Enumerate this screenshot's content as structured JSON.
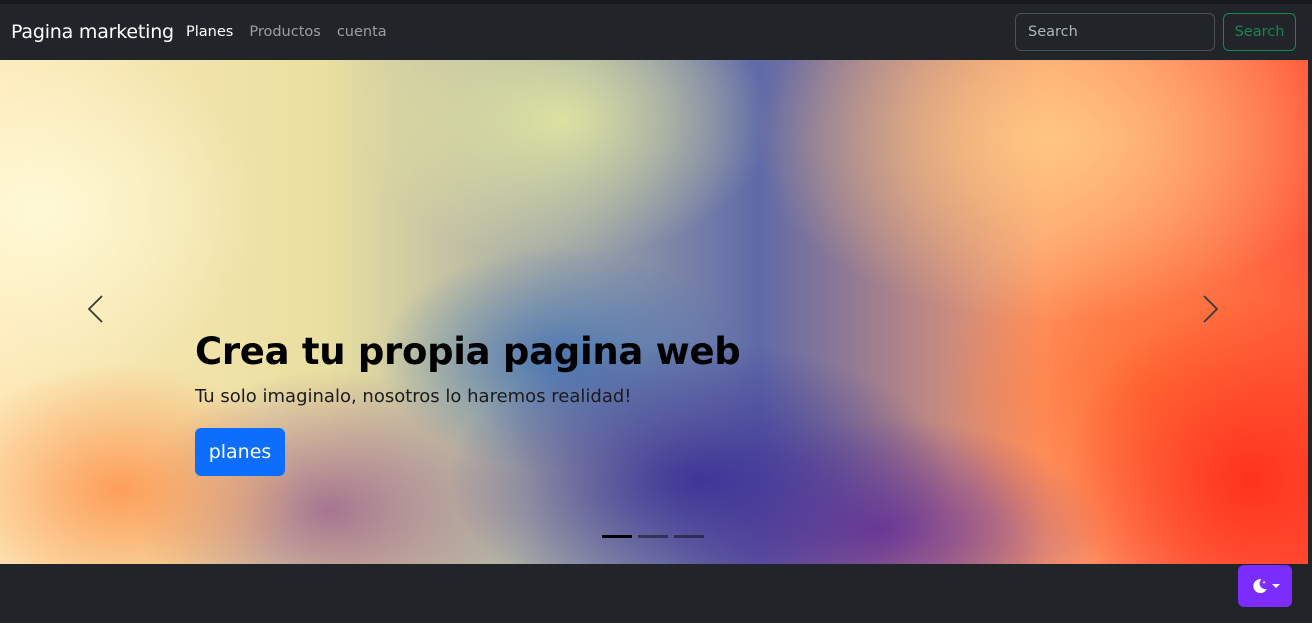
{
  "navbar": {
    "brand": "Pagina marketing",
    "links": [
      {
        "label": "Planes",
        "active": true
      },
      {
        "label": "Productos",
        "active": false
      },
      {
        "label": "cuenta",
        "active": false
      }
    ],
    "search": {
      "placeholder": "Search",
      "value": "",
      "button_label": "Search"
    }
  },
  "carousel": {
    "title": "Crea tu propia pagina web",
    "subtitle": "Tu solo imaginalo, nosotros lo haremos realidad!",
    "button_label": "planes",
    "prev_icon": "chevron-left-icon",
    "next_icon": "chevron-right-icon",
    "slide_count": 3,
    "active_slide": 1
  },
  "theme_toggle": {
    "icon": "moon-stars-icon",
    "dropdown_icon": "caret-down-icon",
    "color": "#7b2cff"
  },
  "colors": {
    "navbar_bg": "#212529",
    "primary": "#0d6efd",
    "success": "#198754"
  }
}
